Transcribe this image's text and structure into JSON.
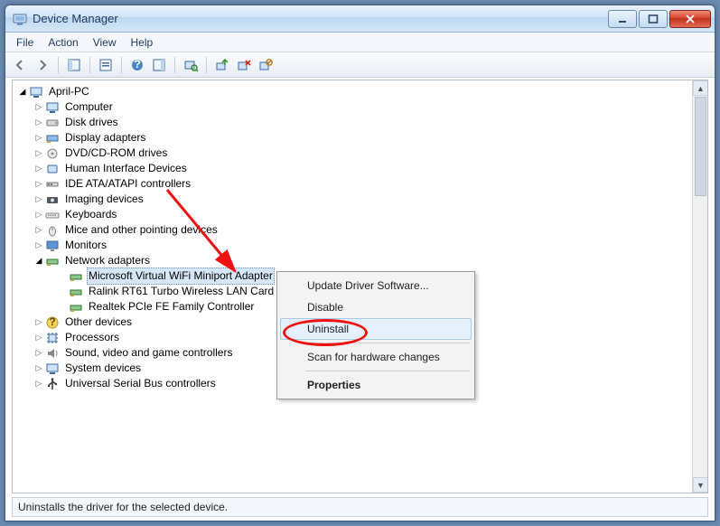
{
  "window": {
    "title": "Device Manager"
  },
  "menus": {
    "file": "File",
    "action": "Action",
    "view": "View",
    "help": "Help"
  },
  "status": "Uninstalls the driver for the selected device.",
  "tree": {
    "root": "April-PC",
    "items": [
      {
        "label": "Computer"
      },
      {
        "label": "Disk drives"
      },
      {
        "label": "Display adapters"
      },
      {
        "label": "DVD/CD-ROM drives"
      },
      {
        "label": "Human Interface Devices"
      },
      {
        "label": "IDE ATA/ATAPI controllers"
      },
      {
        "label": "Imaging devices"
      },
      {
        "label": "Keyboards"
      },
      {
        "label": "Mice and other pointing devices"
      },
      {
        "label": "Monitors"
      },
      {
        "label": "Network adapters",
        "expanded": true,
        "children": [
          {
            "label": "Microsoft Virtual WiFi Miniport Adapter",
            "selected": true
          },
          {
            "label": "Ralink RT61 Turbo Wireless LAN Card"
          },
          {
            "label": "Realtek PCIe FE Family Controller"
          }
        ]
      },
      {
        "label": "Other devices"
      },
      {
        "label": "Processors"
      },
      {
        "label": "Sound, video and game controllers"
      },
      {
        "label": "System devices"
      },
      {
        "label": "Universal Serial Bus controllers"
      }
    ]
  },
  "context_menu": {
    "update": "Update Driver Software...",
    "disable": "Disable",
    "uninstall": "Uninstall",
    "scan": "Scan for hardware changes",
    "properties": "Properties"
  }
}
